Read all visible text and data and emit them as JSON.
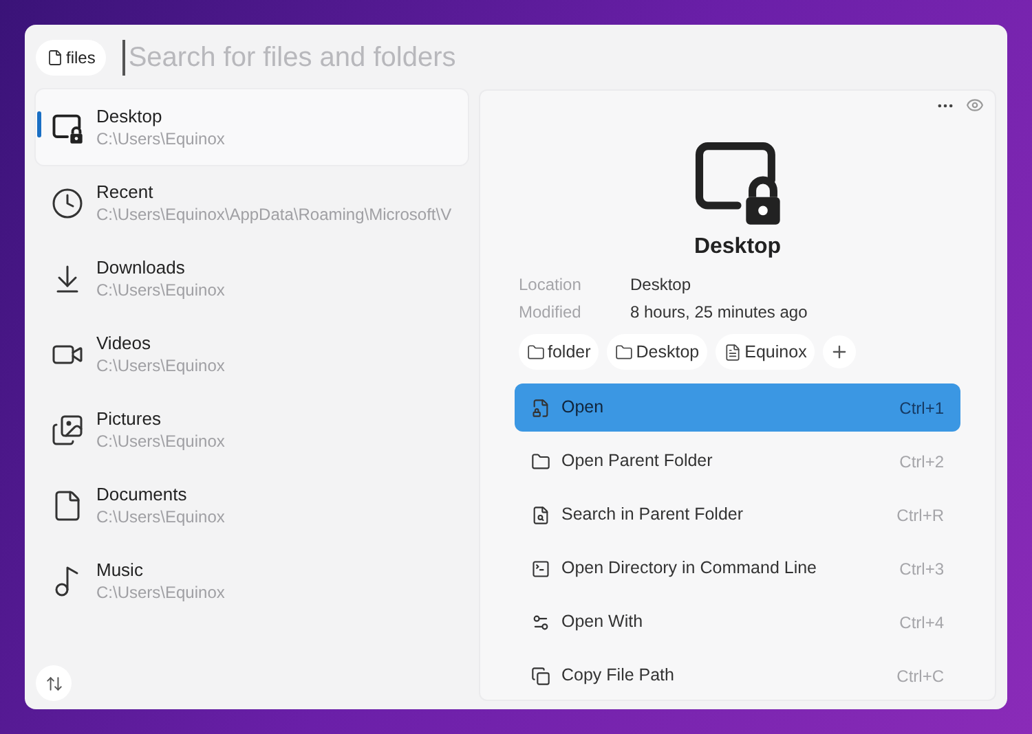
{
  "search": {
    "scope": "files",
    "placeholder": "Search for files and folders"
  },
  "sidebar": {
    "items": [
      {
        "kind": "desktop",
        "name": "Desktop",
        "path": "C:\\Users\\Equinox",
        "selected": true
      },
      {
        "kind": "clock",
        "name": "Recent",
        "path": "C:\\Users\\Equinox\\AppData\\Roaming\\Microsoft\\V",
        "selected": false
      },
      {
        "kind": "download",
        "name": "Downloads",
        "path": "C:\\Users\\Equinox",
        "selected": false
      },
      {
        "kind": "video",
        "name": "Videos",
        "path": "C:\\Users\\Equinox",
        "selected": false
      },
      {
        "kind": "picture",
        "name": "Pictures",
        "path": "C:\\Users\\Equinox",
        "selected": false
      },
      {
        "kind": "document",
        "name": "Documents",
        "path": "C:\\Users\\Equinox",
        "selected": false
      },
      {
        "kind": "music",
        "name": "Music",
        "path": "C:\\Users\\Equinox",
        "selected": false
      }
    ]
  },
  "preview": {
    "title": "Desktop",
    "details": [
      {
        "label": "Location",
        "value": "Desktop"
      },
      {
        "label": "Modified",
        "value": "8 hours, 25 minutes ago"
      }
    ],
    "tags": [
      {
        "kind": "folder",
        "label": "folder"
      },
      {
        "kind": "folder",
        "label": "Desktop"
      },
      {
        "kind": "file",
        "label": "Equinox"
      }
    ],
    "actions": [
      {
        "kind": "open",
        "label": "Open",
        "shortcut": "Ctrl+1",
        "selected": true
      },
      {
        "kind": "folder",
        "label": "Open Parent Folder",
        "shortcut": "Ctrl+2",
        "selected": false
      },
      {
        "kind": "search",
        "label": "Search in Parent Folder",
        "shortcut": "Ctrl+R",
        "selected": false
      },
      {
        "kind": "terminal",
        "label": "Open Directory in Command Line",
        "shortcut": "Ctrl+3",
        "selected": false
      },
      {
        "kind": "openwith",
        "label": "Open With",
        "shortcut": "Ctrl+4",
        "selected": false
      },
      {
        "kind": "copy",
        "label": "Copy File Path",
        "shortcut": "Ctrl+C",
        "selected": false
      }
    ]
  }
}
